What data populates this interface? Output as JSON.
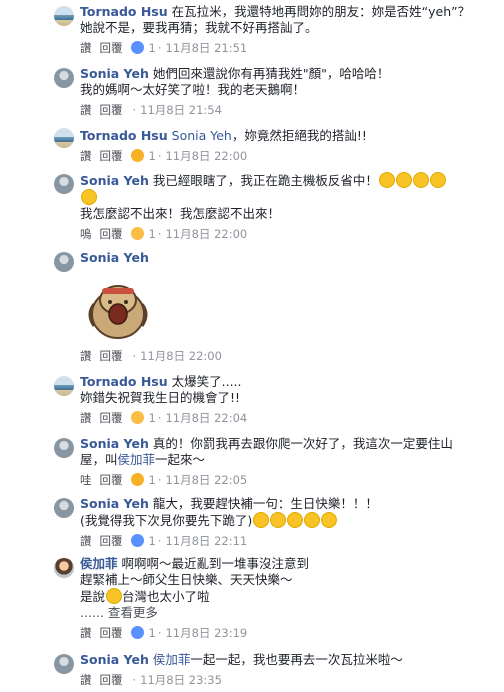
{
  "comments": [
    {
      "author": "Tornado Hsu",
      "text1": "在瓦拉米，我還特地再問妳的朋友：妳是否姓“yeh”？",
      "text2": "她說不是，要我再猜；我就不好再搭訕了。",
      "actions": {
        "like": "讚",
        "reply": "回覆",
        "count": "1",
        "time": "11月8日 21:51"
      }
    },
    {
      "author": "Sonia Yeh",
      "text1": "她們回來還說你有再猜我姓\"顏\"，哈哈哈！",
      "text2": "我的媽啊～太好笑了啦！我的老天鵝啊！",
      "actions": {
        "like": "讚",
        "reply": "回覆",
        "time": "11月8日 21:54"
      }
    },
    {
      "author": "Tornado Hsu",
      "tag": "Sonia Yeh",
      "text1": "，妳竟然拒絕我的搭訕!!",
      "actions": {
        "like": "讚",
        "reply": "回覆",
        "count": "1",
        "time": "11月8日 22:00"
      }
    },
    {
      "author": "Sonia Yeh",
      "text1": "我已經眼瞎了，我正在跪主機板反省中！",
      "text2": "我怎麼認不出來！我怎麼認不出來！",
      "actions": {
        "like": "嗚",
        "reply": "回覆",
        "count": "1",
        "time": "11月8日 22:00"
      }
    },
    {
      "author": "Sonia Yeh",
      "actions": {
        "like": "讚",
        "reply": "回覆",
        "time": "11月8日 22:00"
      }
    },
    {
      "author": "Tornado Hsu",
      "text1": "太爆笑了.....",
      "text2": "妳錯失祝賀我生日的機會了!!",
      "actions": {
        "like": "讚",
        "reply": "回覆",
        "count": "1",
        "time": "11月8日 22:04"
      }
    },
    {
      "author": "Sonia Yeh",
      "text1": "真的！你罰我再去跟你爬一次好了，我這次一定要住山",
      "text2a": "屋，叫",
      "tag": "侯加菲",
      "text2b": "一起來～",
      "actions": {
        "like": "哇",
        "reply": "回覆",
        "count": "1",
        "time": "11月8日 22:05"
      }
    },
    {
      "author": "Sonia Yeh",
      "text1": "龍大，我要趕快補一句：生日快樂！！！",
      "text2": "(我覺得我下次見你要先下跪了)",
      "actions": {
        "like": "讚",
        "reply": "回覆",
        "count": "1",
        "time": "11月8日 22:11"
      }
    },
    {
      "author": "侯加菲",
      "text1": "啊啊啊～最近亂到一堆事沒注意到",
      "text2": "趕緊補上～師父生日快樂、天天快樂～",
      "text3a": "是說",
      "text3b": "台灣也太小了啦",
      "see_more": "...... 查看更多",
      "actions": {
        "like": "讚",
        "reply": "回覆",
        "count": "1",
        "time": "11月8日 23:19"
      }
    },
    {
      "author": "Sonia Yeh",
      "tag": "侯加菲",
      "text1": "一起一起，我也要再去一次瓦拉米啦～",
      "actions": {
        "like": "讚",
        "reply": "回覆",
        "time": "11月8日 23:35"
      }
    }
  ]
}
